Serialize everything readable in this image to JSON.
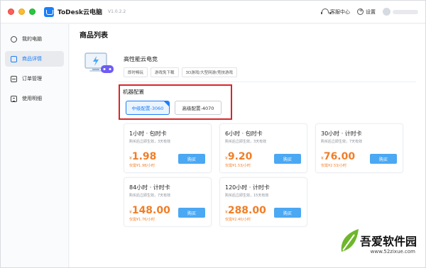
{
  "app": {
    "title": "ToDesk云电脑",
    "version": "V1.0.2.2"
  },
  "header": {
    "support": "客服中心",
    "settings": "设置"
  },
  "sidebar": {
    "items": [
      {
        "label": "我的电脑"
      },
      {
        "label": "商品详情"
      },
      {
        "label": "订单管理"
      },
      {
        "label": "使用明细"
      }
    ]
  },
  "main": {
    "page_title": "商品列表",
    "product": {
      "name": "高性能云电竞",
      "tags": [
        "即时畅玩",
        "游戏免下载",
        "3D游戏/大型网游/竞技游戏"
      ]
    },
    "config": {
      "label": "机器配置",
      "options": [
        "中级配置-3060",
        "高级配置-4070"
      ]
    },
    "cards": [
      {
        "title": "1小时 · 包时卡",
        "sub": "购买后立即生效，3天有效",
        "yen": "¥",
        "price": "1.98",
        "unit": "仅需¥1.98/小时",
        "buy": "购买"
      },
      {
        "title": "6小时 · 包时卡",
        "sub": "购买后立即生效，3天有效",
        "yen": "¥",
        "price": "9.20",
        "unit": "仅需¥1.53/小时",
        "buy": "购买"
      },
      {
        "title": "30小时 · 计时卡",
        "sub": "购买后立即生效，7天有效",
        "yen": "¥",
        "price": "76.00",
        "unit": "仅需¥2.53/小时",
        "buy": "购买"
      },
      {
        "title": "84小时 · 计时卡",
        "sub": "购买后立即生效，7天有效",
        "yen": "¥",
        "price": "148.00",
        "unit": "仅需¥1.76/小时",
        "buy": "购买"
      },
      {
        "title": "120小时 · 计时卡",
        "sub": "购买后立即生效，15天有效",
        "yen": "¥",
        "price": "288.00",
        "unit": "仅需¥2.40/小时",
        "buy": "购买"
      }
    ]
  },
  "watermark": {
    "text": "吾爱软件园",
    "url": "www.52zixue.com"
  },
  "colors": {
    "accent": "#1a7ffa",
    "price": "#f07e28",
    "buy": "#4ba8f3",
    "highlight_box": "#d9252b"
  }
}
